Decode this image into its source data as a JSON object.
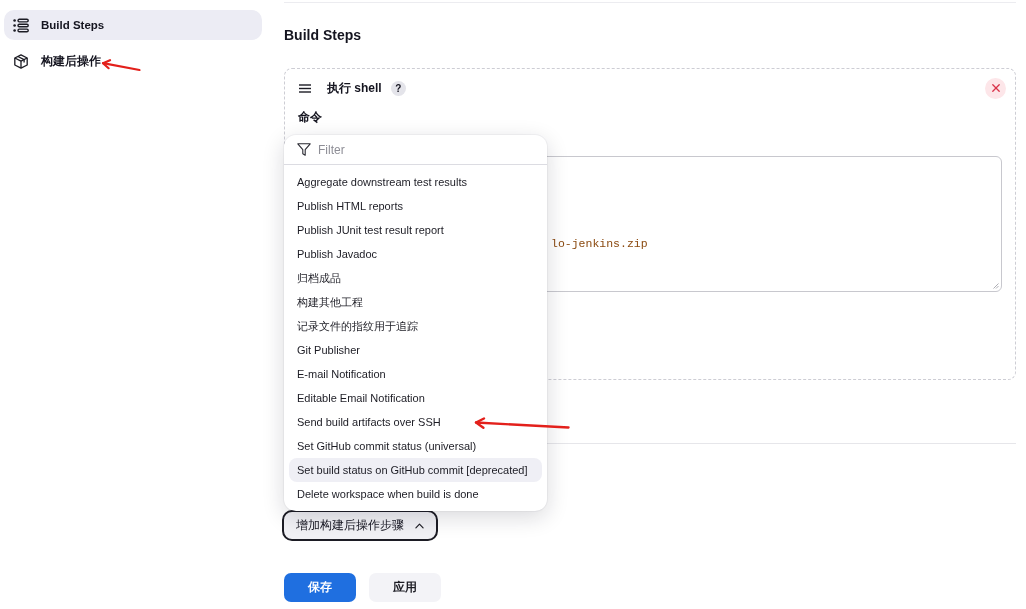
{
  "sidebar": {
    "items": [
      {
        "label": "Build Steps",
        "selected": true
      },
      {
        "label": "构建后操作",
        "selected": false
      }
    ]
  },
  "build_steps": {
    "title": "Build Steps",
    "step": {
      "title": "执行 shell",
      "help": "?",
      "command_label": "命令",
      "command_value": "lo-jenkins.zip"
    }
  },
  "post_build": {
    "add_button": {
      "label": "增加构建后操作步骤",
      "expanded": true
    },
    "menu": {
      "filter_placeholder": "Filter",
      "items": [
        {
          "label": "Aggregate downstream test results",
          "selected": false
        },
        {
          "label": "Publish HTML reports",
          "selected": false
        },
        {
          "label": "Publish JUnit test result report",
          "selected": false
        },
        {
          "label": "Publish Javadoc",
          "selected": false
        },
        {
          "label": "归档成品",
          "selected": false
        },
        {
          "label": "构建其他工程",
          "selected": false
        },
        {
          "label": "记录文件的指纹用于追踪",
          "selected": false
        },
        {
          "label": "Git Publisher",
          "selected": false
        },
        {
          "label": "E-mail Notification",
          "selected": false
        },
        {
          "label": "Editable Email Notification",
          "selected": false
        },
        {
          "label": "Send build artifacts over SSH",
          "selected": false
        },
        {
          "label": "Set GitHub commit status (universal)",
          "selected": false
        },
        {
          "label": "Set build status on GitHub commit [deprecated]",
          "selected": true
        },
        {
          "label": "Delete workspace when build is done",
          "selected": false
        }
      ]
    }
  },
  "buttons": [
    {
      "label": "保存",
      "kind": "primary"
    },
    {
      "label": "应用",
      "kind": "secondary"
    }
  ]
}
